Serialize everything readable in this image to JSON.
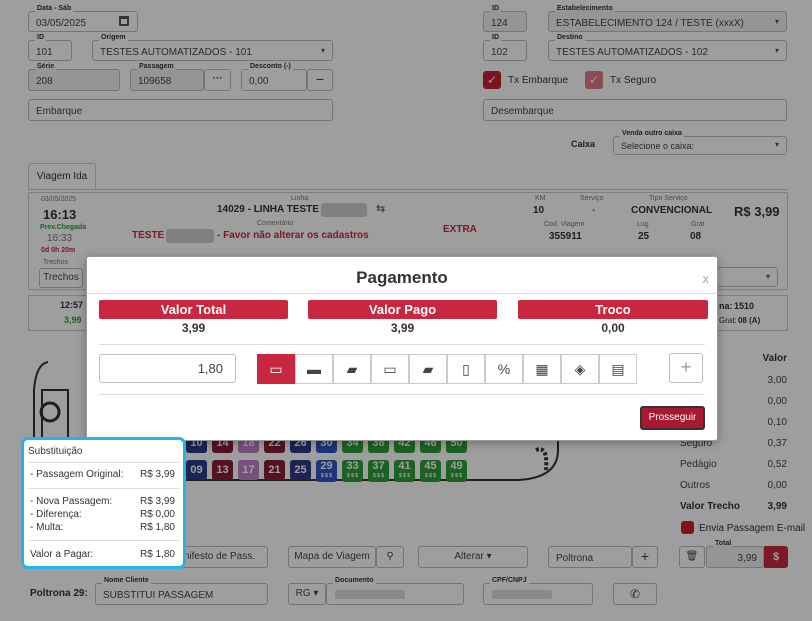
{
  "top_left": {
    "date": {
      "label": "Data - Sáb",
      "value": "03/05/2025"
    },
    "origin_id": {
      "label": "ID",
      "value": "101"
    },
    "origin": {
      "label": "Origem",
      "value": "TESTES AUTOMATIZADOS - 101"
    },
    "serie": {
      "label": "Série",
      "value": "208"
    },
    "passagem": {
      "label": "Passagem",
      "value": "109658"
    },
    "desconto": {
      "label": "Desconto (-)",
      "value": "0,00"
    },
    "embarque_placeholder": "Embarque"
  },
  "top_right": {
    "estab_id": {
      "label": "ID",
      "value": "124"
    },
    "estab": {
      "label": "Estabelecimento",
      "value": "ESTABELECIMENTO 124 / TESTE (xxxX)"
    },
    "dest_id": {
      "label": "ID",
      "value": "102"
    },
    "dest": {
      "label": "Destino",
      "value": "TESTES AUTOMATIZADOS - 102"
    },
    "tx_embarque": "Tx Embarque",
    "tx_seguro": "Tx Seguro",
    "desembarque_placeholder": "Desembarque",
    "caixa_label": "Caixa",
    "venda_outro_caixa": {
      "label": "Venda outro caixa",
      "placeholder": "Selecione o caixa:"
    }
  },
  "trip": {
    "tab": "Viagem Ida",
    "date": "03/05/2025",
    "time": "16:13",
    "prev_chegada_label": "Prev.Chegada",
    "prev_chegada": "16:33",
    "duration": "0d 0h 20m",
    "linha_label": "Linha",
    "linha": "14029 - LINHA TESTE",
    "km_label": "KM",
    "km": "10",
    "servico_label": "Serviço",
    "servico": "-",
    "tipo_servico_label": "Tipo Serviço",
    "tipo_servico": "CONVENCIONAL",
    "price": "R$ 3,99",
    "comentario_label": "Comentário",
    "comentario_prefix": "TESTE",
    "comentario_suffix": "- Favor não alterar os cadastros",
    "extra": "EXTRA",
    "cod_viagem_label": "Cod. Viagem",
    "cod_viagem": "355911",
    "lug_label": "Lug",
    "lug": "25",
    "grat_label": "Grat",
    "grat": "08",
    "trechos_label": "Trechos",
    "trechos_button": "Trechos",
    "mini_time": "12:57",
    "mini_price": "3,99",
    "plataforma_label": "na:",
    "plataforma": "1510",
    "grat_info_label": "Grat:",
    "grat_info": "08 (A)"
  },
  "payment": {
    "title": "Pagamento",
    "close": "x",
    "valor_total_label": "Valor Total",
    "valor_total": "3,99",
    "valor_pago_label": "Valor Pago",
    "valor_pago": "3,99",
    "troco_label": "Troco",
    "troco": "0,00",
    "amount": "1,80",
    "add": "+",
    "proceed": "Prosseguir",
    "methods": [
      "cash-icon",
      "credit-card-icon",
      "ticket-icon",
      "debit-card-icon",
      "voucher-icon",
      "pos-icon",
      "discount-icon",
      "qrcode-icon",
      "pix-icon",
      "transfer-icon"
    ]
  },
  "seats_row1": [
    {
      "n": "10",
      "color": "#2b3a8a"
    },
    {
      "n": "14",
      "color": "#8c1c3a"
    },
    {
      "n": "18",
      "color": "#c084c8"
    },
    {
      "n": "22",
      "color": "#8c1c3a"
    },
    {
      "n": "26",
      "color": "#2b3a8a"
    },
    {
      "n": "30",
      "color": "#2f55c8"
    },
    {
      "n": "34",
      "color": "#2e9e3a"
    },
    {
      "n": "38",
      "color": "#2e9e3a"
    },
    {
      "n": "42",
      "color": "#2e9e3a"
    },
    {
      "n": "46",
      "color": "#2e9e3a"
    },
    {
      "n": "50",
      "color": "#2e9e3a"
    }
  ],
  "seats_row2": [
    {
      "n": "09",
      "color": "#2b3a8a",
      "sub": ""
    },
    {
      "n": "13",
      "color": "#8c1c3a",
      "sub": ""
    },
    {
      "n": "17",
      "color": "#c084c8",
      "sub": ""
    },
    {
      "n": "21",
      "color": "#8c1c3a",
      "sub": ""
    },
    {
      "n": "25",
      "color": "#2b3a8a",
      "sub": ""
    },
    {
      "n": "29",
      "color": "#2f55c8",
      "sub": "$ $ $"
    },
    {
      "n": "33",
      "color": "#2e9e3a",
      "sub": "$ $ $"
    },
    {
      "n": "37",
      "color": "#2e9e3a",
      "sub": "$ $ $"
    },
    {
      "n": "41",
      "color": "#2e9e3a",
      "sub": "$ $ $"
    },
    {
      "n": "45",
      "color": "#2e9e3a",
      "sub": "$ $ $"
    },
    {
      "n": "49",
      "color": "#2e9e3a",
      "sub": "$ $ $"
    }
  ],
  "substituicao": {
    "title": "Substituição",
    "passagem_original_label": "- Passagem Original:",
    "passagem_original": "R$ 3,99",
    "nova_passagem_label": "- Nova Passagem:",
    "nova_passagem": "R$ 3,99",
    "diferenca_label": "- Diferença:",
    "diferenca": "R$ 0,00",
    "multa_label": "- Multa:",
    "multa": "R$ 1,80",
    "valor_pagar_label": "Valor a Pagar:",
    "valor_pagar": "R$ 1,80"
  },
  "price_table": {
    "header_label": "ão",
    "header_value": "Valor",
    "rows": [
      {
        "label": "",
        "value": "3,00"
      },
      {
        "label": "o",
        "value": "0,00"
      },
      {
        "label": "",
        "value": "0,10"
      },
      {
        "label": "Seguro",
        "value": "0,37"
      },
      {
        "label": "Pedágio",
        "value": "0,52"
      },
      {
        "label": "Outros",
        "value": "0,00"
      }
    ],
    "valor_trecho_label": "Valor Trecho",
    "valor_trecho": "3,99",
    "email_label": "Envia Passagem E-mail",
    "total_label": "Total",
    "total": "3,99"
  },
  "bottom": {
    "manifesto": "nifesto de Pass.",
    "mapa": "Mapa de Viagem",
    "alterar": "Alterar",
    "poltrona_placeholder": "Poltrona",
    "poltrona_label": "Poltrona 29:",
    "nome_label": "Nome Cliente",
    "nome": "SUBSTITUI PASSAGEM",
    "doc_type": "RG",
    "documento_label": "Documento",
    "cpf_label": "CPF/CNPJ"
  },
  "colors": {
    "accent": "#c8273f",
    "callout": "#25b4e8",
    "seat_green": "#2e9e3a"
  }
}
